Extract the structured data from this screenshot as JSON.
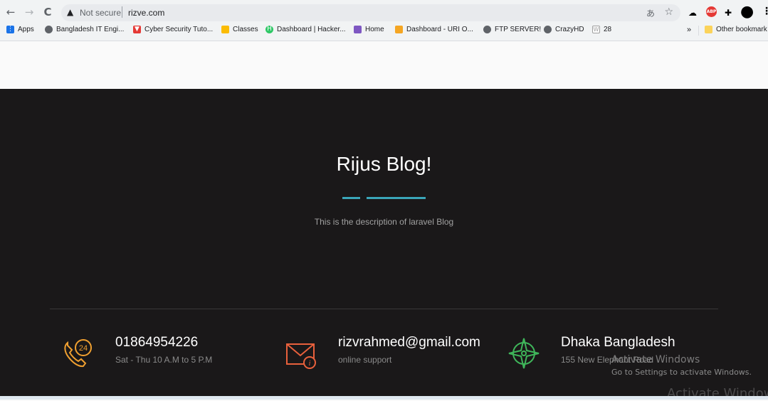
{
  "browser": {
    "back_glyph": "←",
    "forward_glyph": "→",
    "reload_glyph": "C",
    "security_glyph": "▲",
    "security_text": "Not secure",
    "url": "rizve.com",
    "translate_glyph": "あ",
    "star_glyph": "☆",
    "extensions": [
      {
        "name": "cloud-icon",
        "glyph": "☁",
        "color": "#5f6368"
      },
      {
        "name": "adblock-icon",
        "glyph": "ABP",
        "color": "#e53935"
      },
      {
        "name": "puzzle-icon",
        "glyph": "✚",
        "color": "#202124"
      },
      {
        "name": "profile-avatar",
        "glyph": "●",
        "color": "#000000"
      },
      {
        "name": "kebab-menu-icon",
        "glyph": "⋮",
        "color": "#202124"
      }
    ]
  },
  "bookmarks": [
    {
      "label": "Apps",
      "icon": "apps-grid-icon",
      "color": "#1a73e8"
    },
    {
      "label": "Bangladesh IT Engi...",
      "icon": "globe-icon",
      "color": "#5f6368"
    },
    {
      "label": "Cyber Security Tuto...",
      "icon": "shield-icon",
      "color": "#e53935"
    },
    {
      "label": "Classes",
      "icon": "classroom-icon",
      "color": "#fbbc04"
    },
    {
      "label": "Dashboard | Hacker...",
      "icon": "hackerrank-icon",
      "color": "#2ec866"
    },
    {
      "label": "Home",
      "icon": "home-icon",
      "color": "#7e57c2"
    },
    {
      "label": "Dashboard - URI O...",
      "icon": "uri-icon",
      "color": "#f5a623"
    },
    {
      "label": "FTP SERVER!",
      "icon": "globe-icon",
      "color": "#5f6368"
    },
    {
      "label": "CrazyHD",
      "icon": "globe-icon",
      "color": "#5f6368"
    },
    {
      "label": "28",
      "icon": "w-icon",
      "color": "#9e9e9e"
    }
  ],
  "bookmarks_overflow": "»",
  "other_bookmarks": "Other bookmark",
  "blog": {
    "title": "Rijus Blog!",
    "description": "This is the description of laravel Blog"
  },
  "contact": [
    {
      "main": "01864954226",
      "sub": "Sat - Thu 10 A.M to 5 P.M",
      "icon": "phone-24-icon",
      "color": "#f0a030"
    },
    {
      "main": "rizvrahmed@gmail.com",
      "sub": "online support",
      "icon": "mail-info-icon",
      "color": "#e8603c"
    },
    {
      "main": "Dhaka Bangladesh",
      "sub": "155 New Elephant Road",
      "icon": "compass-icon",
      "color": "#3fb55a"
    }
  ],
  "watermark": {
    "line1": "Activate Windows",
    "line2": "Go to Settings to activate Windows.",
    "line3": "Activate Window"
  }
}
